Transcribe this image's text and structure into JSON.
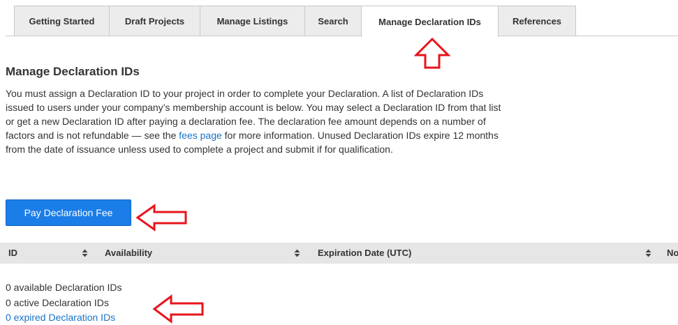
{
  "tabs": [
    {
      "label": "Getting Started",
      "active": false
    },
    {
      "label": "Draft Projects",
      "active": false
    },
    {
      "label": "Manage Listings",
      "active": false
    },
    {
      "label": "Search",
      "active": false
    },
    {
      "label": "Manage Declaration IDs",
      "active": true
    },
    {
      "label": "References",
      "active": false
    }
  ],
  "page": {
    "title": "Manage Declaration IDs",
    "intro_before_link": "You must assign a Declaration ID to your project in order to complete your Declaration. A list of Declaration IDs issued to users under your company’s membership account is below. You may select a Declaration ID from that list or get a new Declaration ID after paying a declaration fee. The declaration fee amount depends on a number of factors and is not refundable — see the ",
    "intro_link": "fees page",
    "intro_after_link": " for more information. Unused Declaration IDs expire 12 months from the date of issuance unless used to complete a project and submit if for qualification."
  },
  "actions": {
    "pay_button_label": "Pay Declaration Fee"
  },
  "table": {
    "columns": [
      "ID",
      "Availability",
      "Expiration Date (UTC)",
      "No"
    ]
  },
  "stats": {
    "available": "0 available Declaration IDs",
    "active": "0 active Declaration IDs",
    "expired": "0 expired Declaration IDs"
  },
  "colors": {
    "accent": "#1a7de8",
    "link": "#1a73c8",
    "annotation": "#e8141c"
  },
  "icons": {
    "sort": "sort-updown-icon",
    "annotation": "outline-arrow-icon"
  }
}
